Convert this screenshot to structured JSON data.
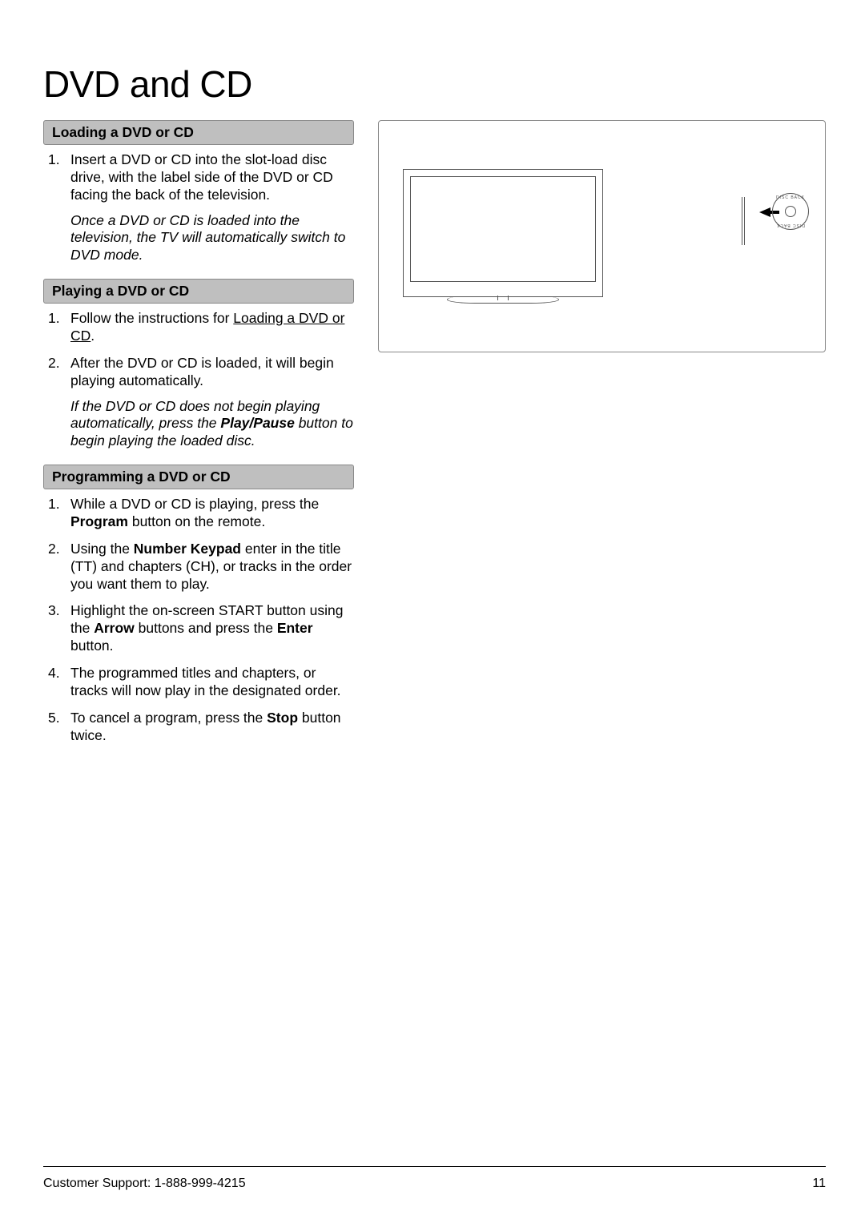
{
  "page_title": "DVD and CD",
  "sections": {
    "loading": {
      "header": "Loading a DVD or CD",
      "step1": "Insert a DVD or CD into the slot-load disc drive, with the label side of the DVD or CD facing the back of the television.",
      "note": "Once a DVD  or CD is loaded into the television, the TV will automatically switch to DVD mode."
    },
    "playing": {
      "header": "Playing a DVD or CD",
      "step1_a": "Follow the instructions for ",
      "step1_link": "Loading a DVD or CD",
      "step1_b": ".",
      "step2": "After the DVD or CD is loaded, it will begin playing automatically.",
      "note_a": "If the DVD or CD does not begin playing automatically, press the ",
      "note_btn": "Play/Pause",
      "note_b": " button to begin playing the loaded disc."
    },
    "programming": {
      "header": "Programming a DVD or CD",
      "step1_a": "While a DVD or CD is playing, press the ",
      "step1_b": "Program",
      "step1_c": " button on the remote.",
      "step2_a": "Using the ",
      "step2_b": "Number Keypad",
      "step2_c": " enter in the title (TT) and chapters (CH), or tracks in the order you want them to play.",
      "step3_a": "Highlight the on-screen START button using the ",
      "step3_b": "Arrow",
      "step3_c": " buttons and press the ",
      "step3_d": "Enter",
      "step3_e": " button.",
      "step4": "The programmed titles and chapters, or tracks will now play in the designated order.",
      "step5_a": "To cancel a program, press the ",
      "step5_b": "Stop",
      "step5_c": " button twice."
    }
  },
  "figure": {
    "disc_label": "DISC BACK"
  },
  "footer": {
    "support": "Customer Support: 1-888-999-4215",
    "page_number": "11"
  }
}
